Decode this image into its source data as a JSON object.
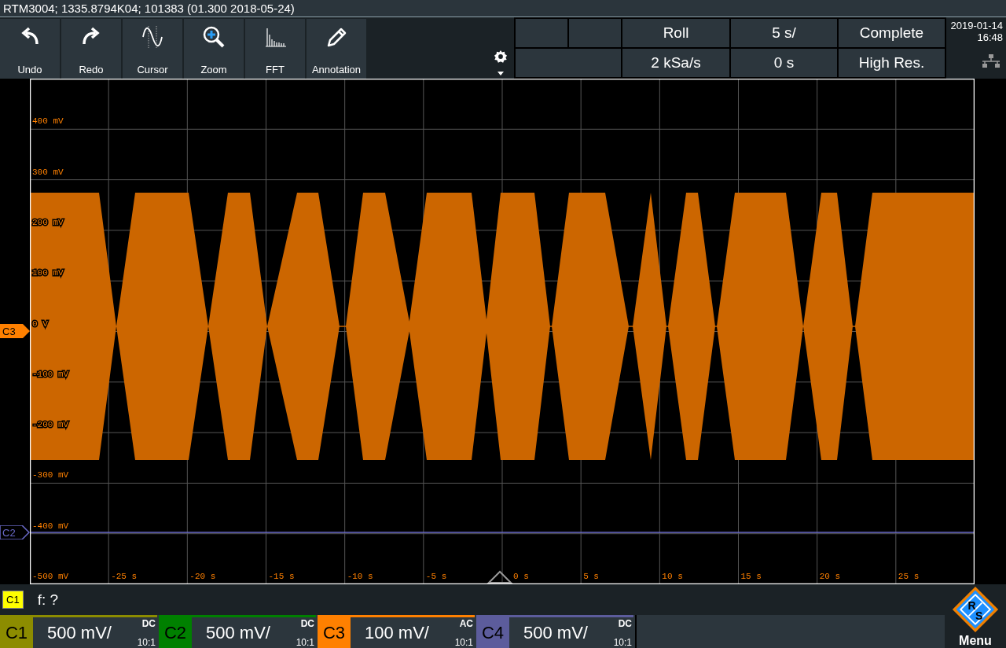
{
  "title_bar": {
    "text": "RTM3004; 1335.8794K04; 101383 (01.300 2018-05-24)"
  },
  "toolbar": [
    {
      "label": "Undo",
      "kind": "undo"
    },
    {
      "label": "Redo",
      "kind": "redo"
    },
    {
      "label": "Cursor",
      "kind": "cursor"
    },
    {
      "label": "Zoom",
      "kind": "zoom"
    },
    {
      "label": "FFT",
      "kind": "fft"
    },
    {
      "label": "Annotation",
      "kind": "annotation"
    }
  ],
  "acquisition": {
    "row_1": [
      "Roll",
      "5 s/",
      "Complete"
    ],
    "row_2": [
      "2 kSa/s",
      "0 s",
      "High Res."
    ]
  },
  "clock": {
    "date": "2019-01-14",
    "time": "16:48"
  },
  "plot": {
    "y_labels": [
      "400 mV",
      "300 mV",
      "200 mV",
      "100 mV",
      "0 V",
      "-100 mV",
      "-200 mV",
      "-300 mV",
      "-400 mV",
      "-500 mV"
    ],
    "x_labels": [
      "-25 s",
      "-20 s",
      "-15 s",
      "-10 s",
      "-5 s",
      "0 s",
      "5 s",
      "10 s",
      "15 s",
      "20 s",
      "25 s"
    ],
    "markers": [
      {
        "label": "C3",
        "color": "#ff8000"
      },
      {
        "label": "C2",
        "color": "#6a6ac8"
      }
    ]
  },
  "measurement": {
    "badge": "C1",
    "text": "f: ?"
  },
  "channels": [
    {
      "name": "C1",
      "color": "#8c8c00",
      "scale": "500 mV/",
      "coupling": "DC",
      "probe": "10:1"
    },
    {
      "name": "C2",
      "color": "#008000",
      "scale": "500 mV/",
      "coupling": "DC",
      "probe": "10:1"
    },
    {
      "name": "C3",
      "color": "#ff8000",
      "scale": "100 mV/",
      "coupling": "AC",
      "probe": "10:1"
    },
    {
      "name": "C4",
      "color": "#5c5c9c",
      "scale": "500 mV/",
      "coupling": "DC",
      "probe": "10:1"
    }
  ],
  "menu": {
    "label": "Menu",
    "logo_letters": [
      "R",
      "S"
    ]
  }
}
